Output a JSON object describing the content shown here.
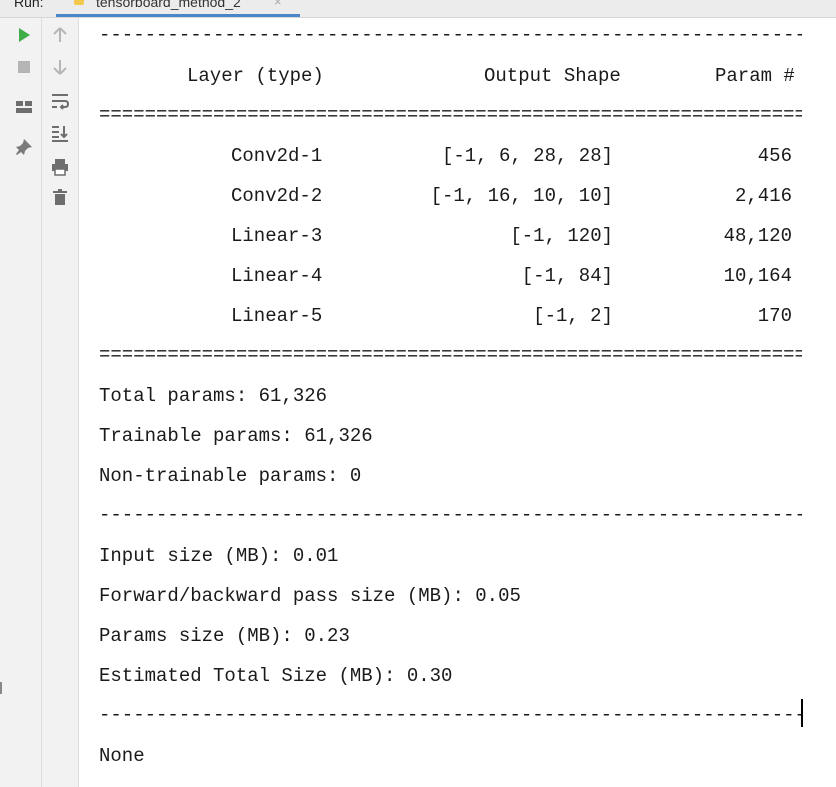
{
  "tabbar": {
    "run_label": "Run:",
    "tab_title": "tensorboard_method_2",
    "close_glyph": "×"
  },
  "toolbar": {
    "left_buttons": [
      "play-icon",
      "stop-icon",
      "layout-icon",
      "pin-icon"
    ],
    "right_buttons": [
      "arrow-up-icon",
      "arrow-down-icon",
      "soft-wrap-icon",
      "scroll-to-end-icon",
      "print-icon",
      "trash-icon"
    ]
  },
  "console": {
    "separator_dash": "----------------------------------------------------------------",
    "separator_eq": "================================================================",
    "header": {
      "layer": "Layer (type)",
      "output_shape": "Output Shape",
      "param": "Param #"
    },
    "rows": [
      {
        "layer": "Conv2d-1",
        "shape": "[-1, 6, 28, 28]",
        "param": "456"
      },
      {
        "layer": "Conv2d-2",
        "shape": "[-1, 16, 10, 10]",
        "param": "2,416"
      },
      {
        "layer": "Linear-3",
        "shape": "[-1, 120]",
        "param": "48,120"
      },
      {
        "layer": "Linear-4",
        "shape": "[-1, 84]",
        "param": "10,164"
      },
      {
        "layer": "Linear-5",
        "shape": "[-1, 2]",
        "param": "170"
      }
    ],
    "total_params": "Total params: 61,326",
    "trainable_params": "Trainable params: 61,326",
    "non_trainable_params": "Non-trainable params: 0",
    "input_size": "Input size (MB): 0.01",
    "forward_backward_size": "Forward/backward pass size (MB): 0.05",
    "params_size": "Params size (MB): 0.23",
    "estimated_total": "Estimated Total Size (MB): 0.30",
    "final_output": "None"
  },
  "colors": {
    "accent_tab": "#4a86c8",
    "play_green": "#3fae49",
    "icon_gray": "#7a7a7a"
  }
}
